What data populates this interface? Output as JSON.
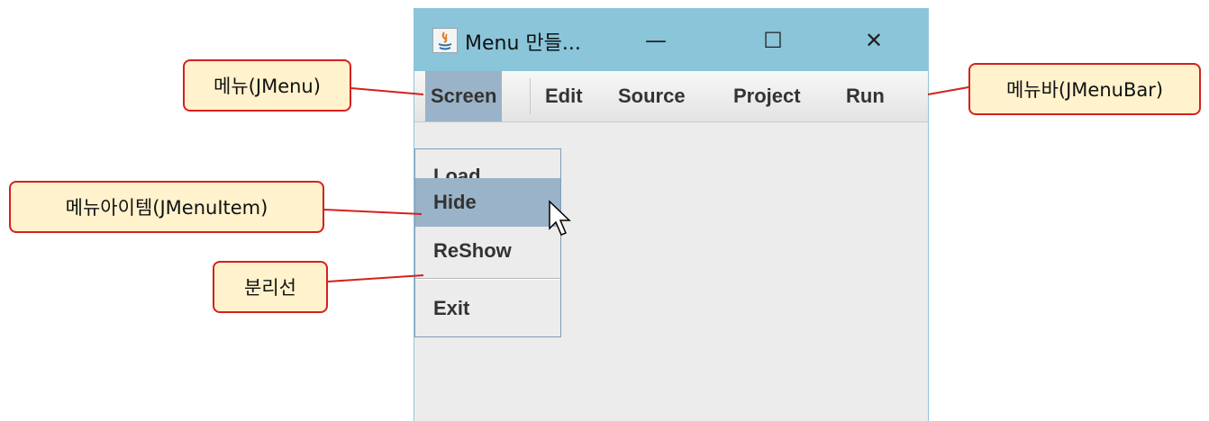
{
  "window": {
    "title": "Menu 만들...",
    "icon": "java-icon",
    "controls": {
      "minimize": "—",
      "maximize": "☐",
      "close": "✕"
    }
  },
  "menubar": {
    "menus": [
      "Screen",
      "Edit",
      "Source",
      "Project",
      "Run"
    ],
    "active_menu": "Screen"
  },
  "dropdown": {
    "items": [
      "Load",
      "Hide",
      "ReShow",
      "Exit"
    ],
    "highlighted_item": "Hide"
  },
  "callouts": {
    "menu": "메뉴(JMenu)",
    "menubar": "메뉴바(JMenuBar)",
    "menu_item": "메뉴아이템(JMenuItem)",
    "separator": "분리선"
  },
  "colors": {
    "titlebar": "#8ac5da",
    "highlight": "#9ab3c8",
    "callout_fill": "#fff2cc",
    "callout_border": "#d4211f"
  }
}
